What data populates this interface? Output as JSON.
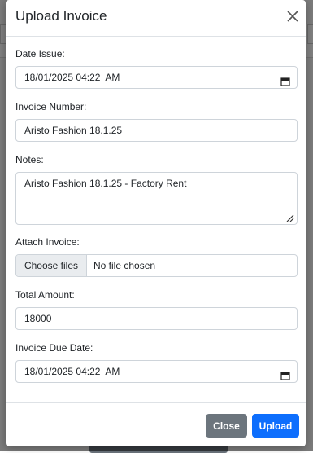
{
  "modal": {
    "title": "Upload Invoice",
    "close_icon": "close-icon"
  },
  "form": {
    "date_issue": {
      "label": "Date Issue:",
      "value": "18/01/2025 04:22  AM",
      "icon": "calendar-icon"
    },
    "invoice_number": {
      "label": "Invoice Number:",
      "value": "Aristo Fashion 18.1.25"
    },
    "notes": {
      "label": "Notes:",
      "value": "Aristo Fashion 18.1.25 - Factory Rent"
    },
    "attach_invoice": {
      "label": "Attach Invoice:",
      "button": "Choose files",
      "status": "No file chosen"
    },
    "total_amount": {
      "label": "Total Amount:",
      "value": "18000"
    },
    "due_date": {
      "label": "Invoice Due Date:",
      "value": "18/01/2025 04:22  AM",
      "icon": "calendar-icon"
    }
  },
  "footer": {
    "close_label": "Close",
    "upload_label": "Upload"
  },
  "colors": {
    "primary": "#0d6efd",
    "secondary": "#6c757d"
  }
}
